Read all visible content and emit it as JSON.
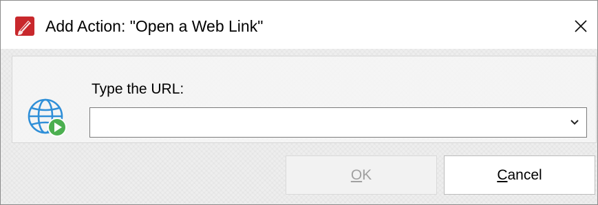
{
  "window": {
    "title": "Add Action: \"Open a Web Link\""
  },
  "form": {
    "url_label": "Type the URL:",
    "url_value": "",
    "url_placeholder": ""
  },
  "buttons": {
    "ok_mnemonic": "O",
    "ok_rest": "K",
    "ok_disabled": true,
    "cancel_mnemonic": "C",
    "cancel_rest": "ancel"
  },
  "icons": {
    "app": "pdf-editor-app-icon",
    "close": "close-icon",
    "web": "globe-play-icon",
    "dropdown": "chevron-down-icon"
  },
  "colors": {
    "app_icon_red": "#c8282c",
    "globe_blue": "#2f8fd8",
    "play_green": "#4caf50"
  }
}
